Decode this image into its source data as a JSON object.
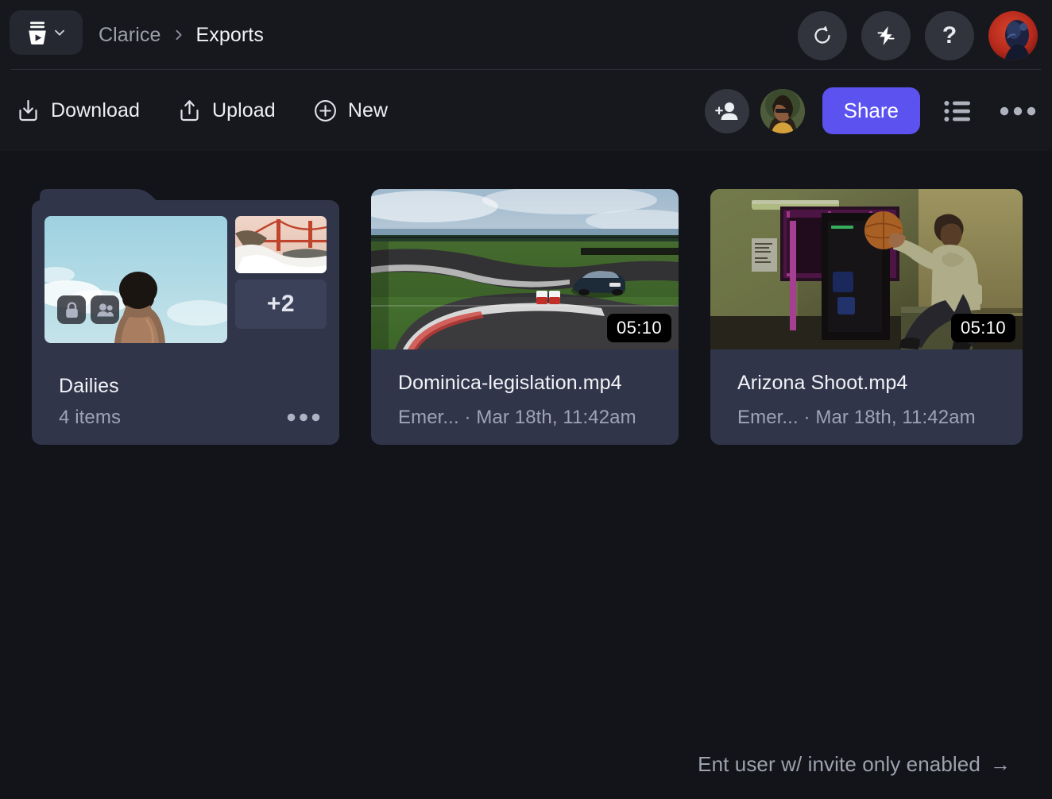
{
  "app": {
    "logo_icon": "film-bucket-play-icon",
    "workspace_chevron_icon": "chevron-down-icon"
  },
  "breadcrumb": {
    "parent": "Clarice",
    "separator_icon": "chevron-right-icon",
    "current": "Exports"
  },
  "header_actions": [
    {
      "name": "refresh",
      "icon": "refresh-icon"
    },
    {
      "name": "activity",
      "icon": "lightning-bolt-icon"
    },
    {
      "name": "help",
      "icon": "question-mark-icon",
      "glyph": "?"
    },
    {
      "name": "account",
      "icon": "user-avatar"
    }
  ],
  "toolbar": {
    "download_label": "Download",
    "download_icon": "download-icon",
    "upload_label": "Upload",
    "upload_icon": "upload-icon",
    "new_label": "New",
    "new_icon": "plus-circle-icon",
    "add_people_icon": "add-person-icon",
    "collaborator_avatar": "collaborator-avatar",
    "share_label": "Share",
    "share_color": "#5B52F0",
    "list_view_icon": "list-view-icon",
    "more_icon": "more-horizontal-icon"
  },
  "items": [
    {
      "type": "folder",
      "title": "Dailies",
      "subtitle": "4 items",
      "overflow_count": "+2",
      "badges": [
        "lock-icon",
        "people-icon"
      ],
      "more_icon": "more-horizontal-icon"
    },
    {
      "type": "video",
      "title": "Dominica-legislation.mp4",
      "meta": "Emer... · Mar 18th, 11:42am",
      "duration": "05:10"
    },
    {
      "type": "video",
      "title": "Arizona Shoot.mp4",
      "meta": "Emer... · Mar 18th, 11:42am",
      "duration": "05:10"
    }
  ],
  "footer": {
    "note": "Ent user w/ invite only enabled",
    "arrow": "→"
  },
  "colors": {
    "background": "#131419",
    "chrome": "#17181D",
    "card": "#30354A",
    "accent": "#5B52F0",
    "text_primary": "#F2F3F7",
    "text_secondary": "#9FA4B4"
  }
}
